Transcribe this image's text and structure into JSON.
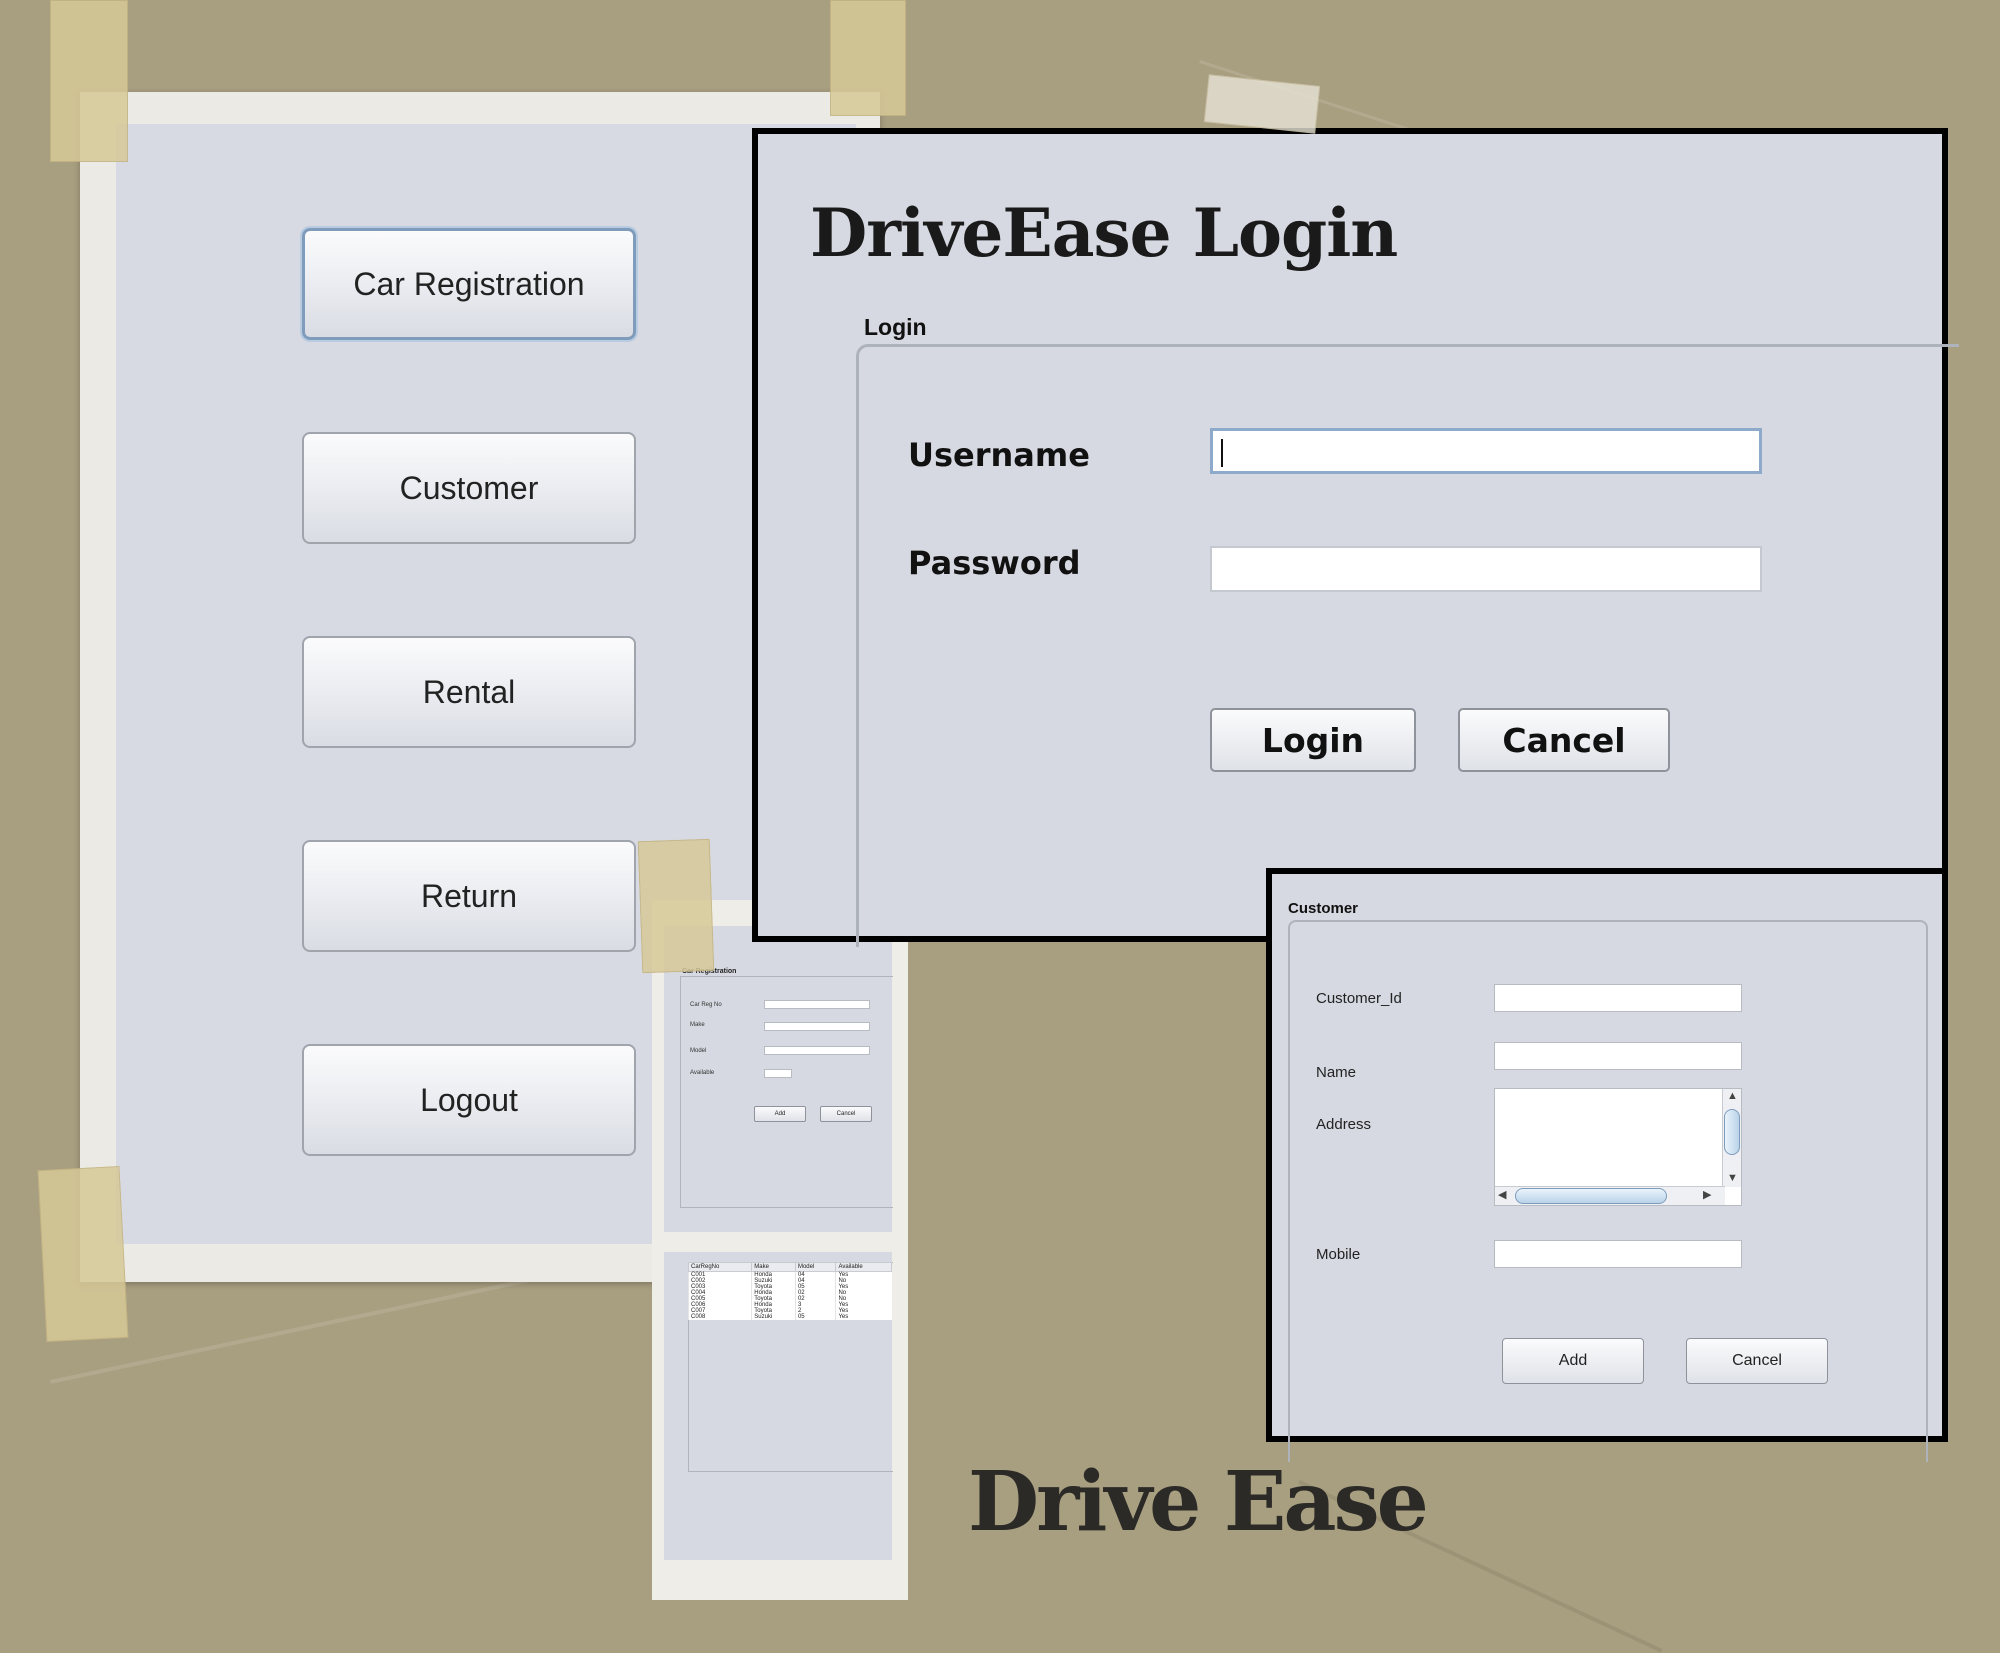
{
  "menu": {
    "buttons": [
      {
        "label": "Car Registration"
      },
      {
        "label": "Customer"
      },
      {
        "label": "Rental"
      },
      {
        "label": "Return"
      },
      {
        "label": "Logout"
      }
    ]
  },
  "login": {
    "title": "DriveEase Login",
    "group_label": "Login",
    "username_label": "Username",
    "username_value": "",
    "password_label": "Password",
    "password_value": "",
    "login_button": "Login",
    "cancel_button": "Cancel"
  },
  "customer": {
    "title": "Customer",
    "fields": {
      "customer_id_label": "Customer_Id",
      "name_label": "Name",
      "address_label": "Address",
      "mobile_label": "Mobile"
    },
    "add_button": "Add",
    "cancel_button": "Cancel"
  },
  "car_registration_thumb": {
    "title": "Car Registration",
    "fields": [
      "Car Reg No",
      "Make",
      "Model",
      "Available"
    ],
    "add_button": "Add",
    "cancel_button": "Cancel"
  },
  "car_table_thumb": {
    "columns": [
      "CarRegNo",
      "Make",
      "Model",
      "Available"
    ],
    "rows": [
      [
        "C001",
        "Honda",
        "04",
        "Yes"
      ],
      [
        "C002",
        "Suzuki",
        "04",
        "No"
      ],
      [
        "C003",
        "Toyota",
        "05",
        "Yes"
      ],
      [
        "C004",
        "Honda",
        "02",
        "No"
      ],
      [
        "C005",
        "Toyota",
        "02",
        "No"
      ],
      [
        "C006",
        "Honda",
        "3",
        "Yes"
      ],
      [
        "C007",
        "Toyota",
        "2",
        "Yes"
      ],
      [
        "C008",
        "Suzuki",
        "05",
        "Yes"
      ]
    ]
  },
  "brand": "Drive Ease",
  "colors": {
    "background": "#a89e80",
    "window_bg": "#d6d9e1",
    "focus_border": "#8eaacb"
  }
}
